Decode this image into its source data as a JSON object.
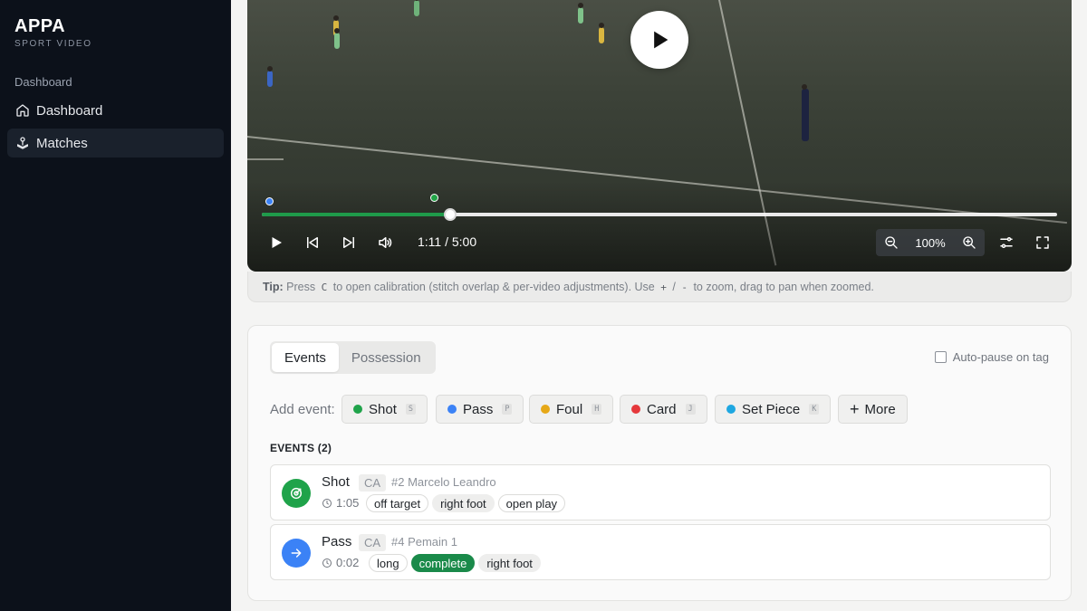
{
  "brand": {
    "title": "APPA",
    "subtitle": "SPORT VIDEO"
  },
  "sidebar": {
    "heading": "Dashboard",
    "items": [
      {
        "label": "Dashboard",
        "icon": "home-icon",
        "active": false
      },
      {
        "label": "Matches",
        "icon": "joystick-icon",
        "active": true
      }
    ]
  },
  "player": {
    "time": "1:11 / 5:00",
    "zoom": "100%",
    "progress_fraction": 0.237,
    "markers": [
      {
        "color": "#3b82f6",
        "fraction": 0.01
      },
      {
        "color": "#22a447",
        "fraction": 0.218
      }
    ]
  },
  "tip": {
    "label": "Tip:",
    "press": "Press",
    "key_c": "C",
    "text1": "to open calibration (stitch overlap & per-video adjustments). Use",
    "key_plus": "+",
    "slash": "/",
    "key_minus": "-",
    "text2": "to zoom, drag to pan when zoomed."
  },
  "panel": {
    "tabs": [
      "Events",
      "Possession"
    ],
    "auto_pause_label": "Auto-pause on tag",
    "add_event_label": "Add event:",
    "event_buttons": [
      {
        "label": "Shot",
        "key": "S",
        "color": "#1fa34a"
      },
      {
        "label": "Pass",
        "key": "P",
        "color": "#3b82f6"
      },
      {
        "label": "Foul",
        "key": "H",
        "color": "#e6a817"
      },
      {
        "label": "Card",
        "key": "J",
        "color": "#e5383b"
      },
      {
        "label": "Set Piece",
        "key": "K",
        "color": "#1ea7e1"
      }
    ],
    "more_label": "More",
    "events_title": "EVENTS (2)",
    "events": [
      {
        "type": "Shot",
        "team": "CA",
        "player": "#2 Marcelo Leandro",
        "time": "1:05",
        "tags": [
          "off target",
          "right foot",
          "open play"
        ],
        "color": "#1fa34a"
      },
      {
        "type": "Pass",
        "team": "CA",
        "player": "#4 Pemain 1",
        "time": "0:02",
        "tags": [
          "long",
          "complete",
          "right foot"
        ],
        "color": "#3b82f6"
      }
    ]
  }
}
